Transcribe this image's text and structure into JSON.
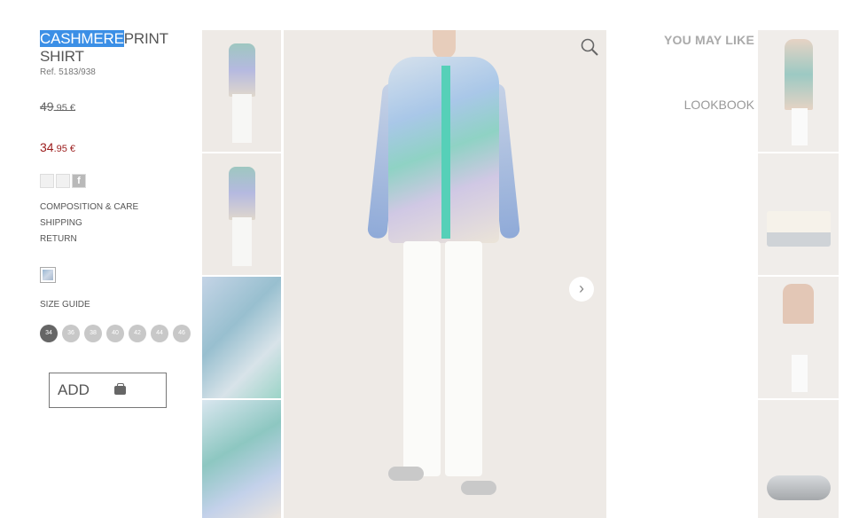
{
  "product": {
    "title_highlight": "CASHMERE",
    "title_rest": "PRINT",
    "title_line2": "SHIRT",
    "ref": "Ref. 5183/938",
    "old_price_int": "49",
    "old_price_dec": ".95 €",
    "new_price_int": "34",
    "new_price_dec": ".95 €",
    "links": [
      "COMPOSITION & CARE",
      "SHIPPING",
      "RETURN"
    ],
    "size_guide": "SIZE GUIDE",
    "sizes": [
      "34",
      "36",
      "38",
      "40",
      "42",
      "44",
      "46"
    ],
    "selected_size": "34",
    "add_label": "ADD"
  },
  "share_icons": [
    "mail-icon",
    "twitter-icon",
    "facebook-icon"
  ],
  "right": {
    "you_may_like": "YOU MAY LIKE",
    "lookbook": "LOOKBOOK"
  },
  "colors": {
    "highlight": "#3b8fe6",
    "sale_price": "#9b1b1b",
    "selected_size": "#666666",
    "size_circle": "#c8c8c8"
  }
}
